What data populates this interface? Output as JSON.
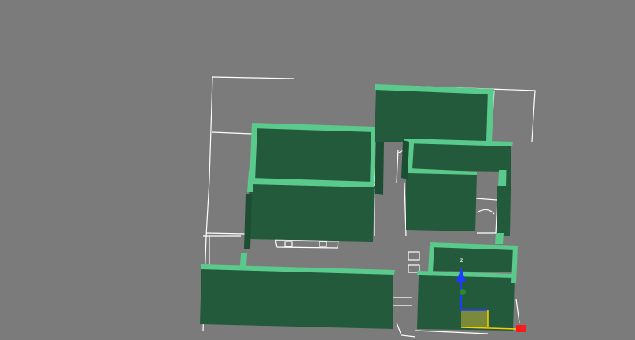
{
  "viewport": {
    "name": "perspective-viewport",
    "background_color": "#7b7b7b",
    "wall_color": "#235a3c",
    "wall_top_color": "#5ac98c",
    "outline_color": "#ffffff"
  },
  "gizmo": {
    "z_label": "z",
    "axis_z_color": "#1e3cff",
    "axis_y_color": "#2a8a2a",
    "axis_x_color": "#ff1a1a",
    "plane_color": "#9a9a3a"
  }
}
